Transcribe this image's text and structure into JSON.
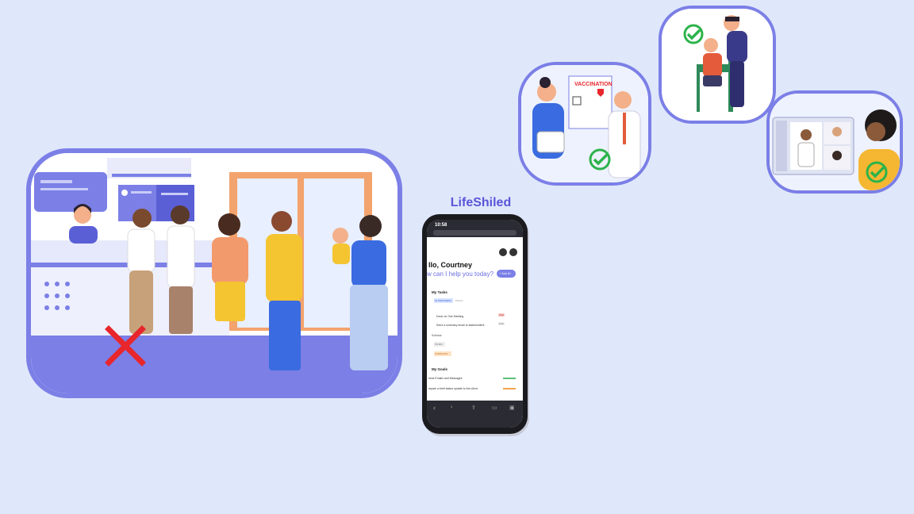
{
  "brand": {
    "name": "LifeShiled"
  },
  "phone": {
    "time": "10:58",
    "greeting": "llo, Courtney",
    "prompt": "w can I help you today?",
    "ask_button": "+ Ask AI",
    "tasks_title": "My Tasks",
    "badge_1": "IN PROGRESS",
    "badge_1_note": "Priority",
    "task_1": "Done on One Meeting",
    "task_1_tag": "High",
    "task_2": "Send a summary email to stakeholders",
    "task_2_tag": "Low",
    "subtask_header": "Subtask",
    "badge_2": "TO DO",
    "badge_3": "COMPLETE",
    "goals_title": "My Goals",
    "goal_1": "heck Emails and Messages",
    "goal_2": "repare a brief status update to the client."
  },
  "scenes": {
    "clinic_status": "rejected",
    "vaccination_sign": "VACCINATION",
    "vaccination_status": "approved",
    "injection_status": "approved",
    "telehealth_status": "approved"
  },
  "colors": {
    "accent": "#7b7fe6",
    "check": "#2db34a",
    "cross": "#e8262c"
  }
}
